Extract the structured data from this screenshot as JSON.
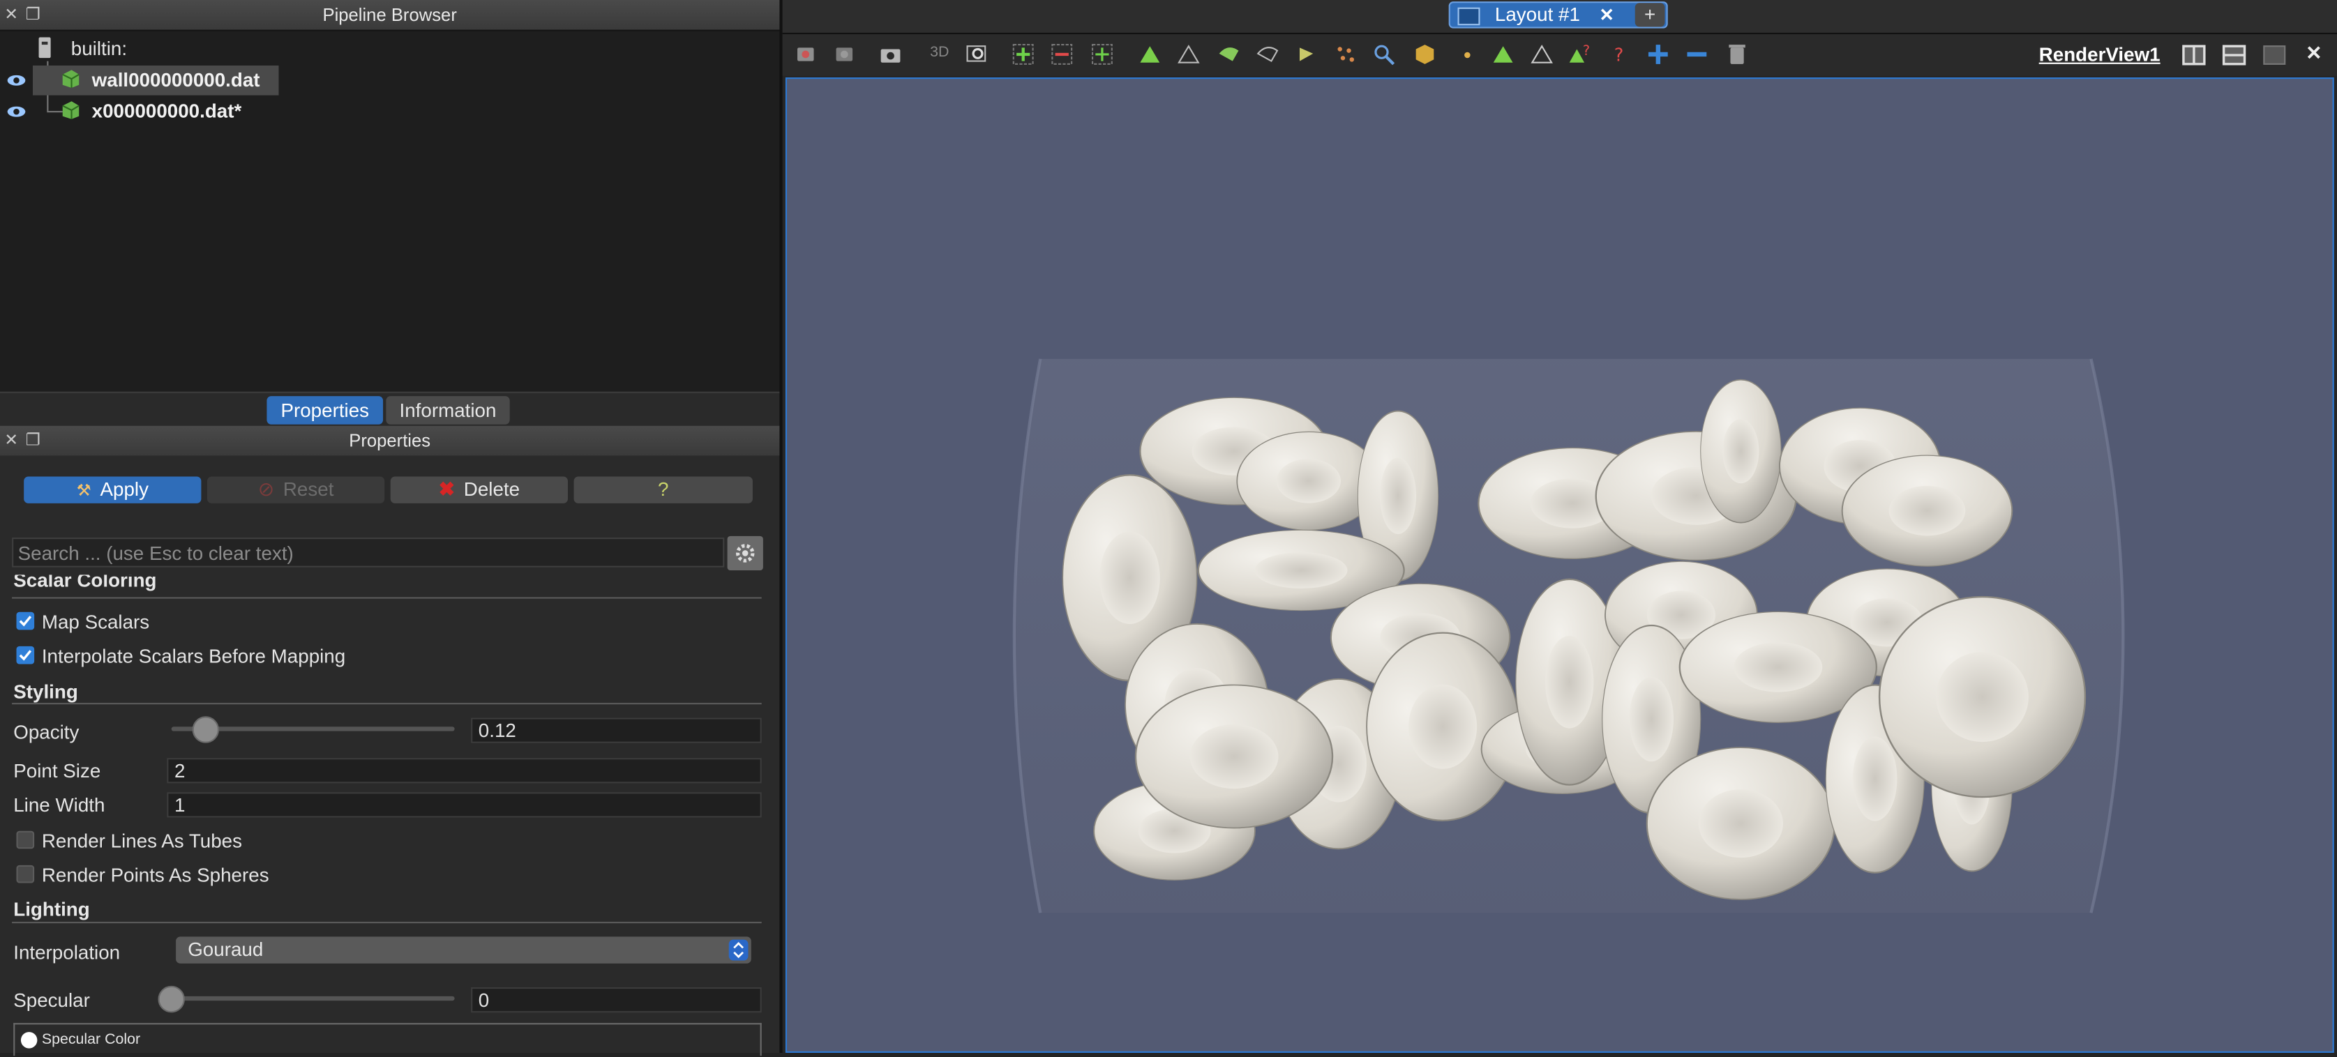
{
  "pipeline": {
    "title": "Pipeline Browser",
    "items": [
      {
        "label": "builtin:"
      },
      {
        "label": "wall000000000.dat"
      },
      {
        "label": "x000000000.dat*"
      }
    ]
  },
  "tabs": {
    "properties": "Properties",
    "information": "Information"
  },
  "properties_panel": {
    "title": "Properties",
    "apply": "Apply",
    "reset": "Reset",
    "delete": "Delete",
    "help": "?",
    "search_placeholder": "Search ... (use Esc to clear text)"
  },
  "scalar_coloring": {
    "title": "Scalar Coloring",
    "map_scalars": {
      "label": "Map Scalars",
      "checked": true
    },
    "interpolate": {
      "label": "Interpolate Scalars Before Mapping",
      "checked": true
    }
  },
  "styling": {
    "title": "Styling",
    "opacity": {
      "label": "Opacity",
      "value": "0.12",
      "fraction": 0.12
    },
    "point_size": {
      "label": "Point Size",
      "value": "2"
    },
    "line_width": {
      "label": "Line Width",
      "value": "1"
    },
    "render_lines_as_tubes": {
      "label": "Render Lines As Tubes",
      "checked": false
    },
    "render_points_as_spheres": {
      "label": "Render Points As Spheres",
      "checked": false
    }
  },
  "lighting": {
    "title": "Lighting",
    "interpolation": {
      "label": "Interpolation",
      "value": "Gouraud"
    },
    "specular": {
      "label": "Specular",
      "value": "0",
      "fraction": 0
    },
    "specular_color": {
      "label": "Specular Color"
    }
  },
  "layout": {
    "tab_label": "Layout #1",
    "add_tab": "+"
  },
  "render_view": {
    "title": "RenderView1",
    "toolbar_3d": "3D"
  },
  "colors": {
    "accent": "#2f6db9",
    "background_3d": "#535a73",
    "delete_x": "#d72525",
    "gouraud_select": "#5a5a5a"
  }
}
